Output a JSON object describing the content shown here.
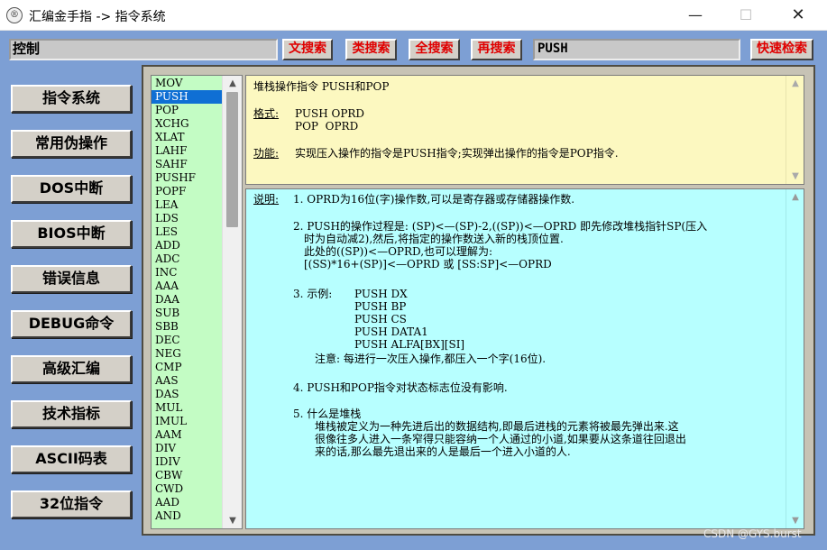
{
  "window": {
    "title": "汇编金手指 -> 指令系统",
    "icon_glyph": "®",
    "minimize": "—",
    "maximize": "☐",
    "close": "✕"
  },
  "toolbar": {
    "control_label": "控制",
    "text_search": "文搜索",
    "category_search": "类搜索",
    "full_search": "全搜索",
    "research": "再搜索",
    "query_value": "PUSH",
    "quick_search": "快速检索"
  },
  "nav": [
    "指令系统",
    "常用伪操作",
    "DOS中断",
    "BIOS中断",
    "错误信息",
    "DEBUG命令",
    "高级汇编",
    "技术指标",
    "ASCII码表",
    "32位指令"
  ],
  "instructions": {
    "selected": "PUSH",
    "items": [
      "MOV",
      "PUSH",
      "POP",
      "XCHG",
      "XLAT",
      "LAHF",
      "SAHF",
      "PUSHF",
      "POPF",
      "LEA",
      "LDS",
      "LES",
      "ADD",
      "ADC",
      "INC",
      "AAA",
      "DAA",
      "SUB",
      "SBB",
      "DEC",
      "NEG",
      "CMP",
      "AAS",
      "DAS",
      "MUL",
      "IMUL",
      "AAM",
      "DIV",
      "IDIV",
      "CBW",
      "CWD",
      "AAD",
      "AND"
    ]
  },
  "summary": {
    "title": "堆栈操作指令 PUSH和POP",
    "format_label": "格式:",
    "format_line1": "PUSH OPRD",
    "format_line2": "POP  OPRD",
    "function_label": "功能:",
    "function_text": "实现压入操作的指令是PUSH指令;实现弹出操作的指令是POP指令."
  },
  "details": {
    "label": "说明:",
    "p1": "1. OPRD为16位(字)操作数,可以是寄存器或存储器操作数.",
    "p2_1": "2. PUSH的操作过程是: (SP)<—(SP)-2,((SP))<—OPRD 即先修改堆栈指针SP(压入",
    "p2_2": "时为自动减2),然后,将指定的操作数送入新的栈顶位置.",
    "p2_3": "此处的((SP))<—OPRD,也可以理解为:",
    "p2_4": "[(SS)*16+(SP)]<—OPRD 或 [SS:SP]<—OPRD",
    "p3_label": "3. 示例:",
    "examples": [
      "PUSH DX",
      "PUSH BP",
      "PUSH CS",
      "PUSH DATA1",
      "PUSH ALFA[BX][SI]"
    ],
    "p3_note": "注意: 每进行一次压入操作,都压入一个字(16位).",
    "p4": "4. PUSH和POP指令对状态标志位没有影响.",
    "p5_title": "5. 什么是堆栈",
    "p5_1": "堆栈被定义为一种先进后出的数据结构,即最后进栈的元素将被最先弹出来.这",
    "p5_2": "很像往多人进入一条窄得只能容纳一个人通过的小道,如果要从这条道往回退出",
    "p5_3": "来的话,那么最先退出来的人是最后一个进入小道的人."
  },
  "watermark": "CSDN @GYS.burst"
}
